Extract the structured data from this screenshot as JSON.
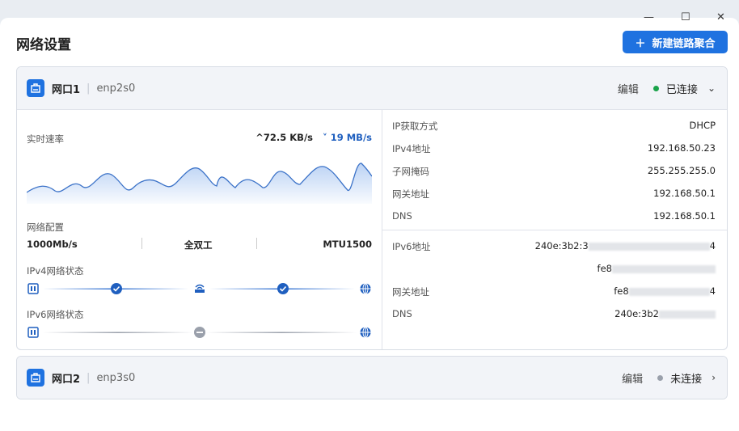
{
  "page": {
    "title": "网络设置",
    "new_button": "新建链路聚合"
  },
  "ports": [
    {
      "name": "网口1",
      "iface": "enp2s0",
      "edit": "编辑",
      "status": "已连接",
      "status_color": "#1aa34a",
      "realtime": {
        "label": "实时速率",
        "up": "72.5 KB/s",
        "down": "19 MB/s",
        "up_icon": "caret-up-icon",
        "down_icon": "chevron-down-icon"
      },
      "net_config": {
        "label": "网络配置",
        "speed": "1000Mb/s",
        "duplex": "全双工",
        "mtu": "MTU1500"
      },
      "ipv4_state": {
        "label": "IPv4网络状态"
      },
      "ipv6_state": {
        "label": "IPv6网络状态"
      },
      "ipv4": [
        {
          "k": "IP获取方式",
          "v": "DHCP"
        },
        {
          "k": "IPv4地址",
          "v": "192.168.50.23"
        },
        {
          "k": "子网掩码",
          "v": "255.255.255.0"
        },
        {
          "k": "网关地址",
          "v": "192.168.50.1"
        },
        {
          "k": "DNS",
          "v": "192.168.50.1"
        }
      ],
      "ipv6": [
        {
          "k": "IPv6地址",
          "v": "240e:3b2:3",
          "v_tail": "4"
        },
        {
          "k": "",
          "v": "fe8"
        },
        {
          "k": "网关地址",
          "v": "fe8",
          "v_tail": "4"
        },
        {
          "k": "DNS",
          "v": "240e:3b2"
        }
      ]
    },
    {
      "name": "网口2",
      "iface": "enp3s0",
      "edit": "编辑",
      "status": "未连接",
      "status_color": "#9aa0ab"
    }
  ],
  "colors": {
    "accent": "#1f72e0"
  }
}
